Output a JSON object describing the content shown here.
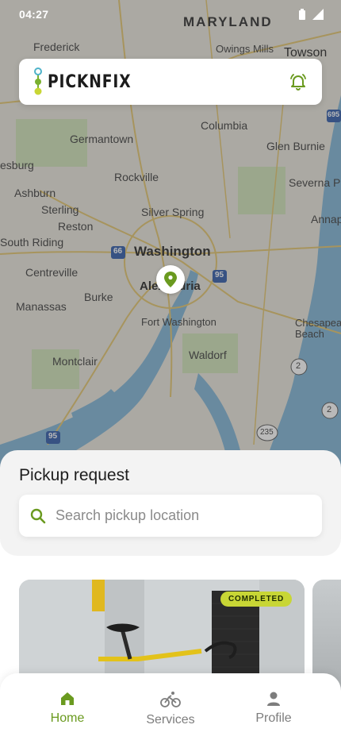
{
  "status_bar": {
    "time": "04:27"
  },
  "header": {
    "logo_text": "PICKNFIX"
  },
  "map": {
    "labels": {
      "maryland": "MARYLAND",
      "frederick": "Frederick",
      "owings_mills": "Owings Mills",
      "towson": "Towson",
      "germantown": "Germantown",
      "columbia": "Columbia",
      "glen_burnie": "Glen Burnie",
      "leesburg": "esburg",
      "rockville": "Rockville",
      "severna_park": "Severna Pa",
      "ashburn": "Ashburn",
      "sterling": "Sterling",
      "silver_spring": "Silver Spring",
      "annapolis": "Annap",
      "reston": "Reston",
      "south_riding": "South Riding",
      "washington": "Washington",
      "centreville": "Centreville",
      "alexandria": "Alexandria",
      "burke": "Burke",
      "manassas": "Manassas",
      "fort_washington": "Fort Washington",
      "chesapeake_beach": "Chesapea Beach",
      "montclair": "Montclair",
      "waldorf": "Waldorf",
      "shield_66": "66",
      "shield_95_a": "95",
      "shield_95_b": "95",
      "shield_2_a": "2",
      "shield_2_b": "2",
      "shield_235": "235",
      "shield_695": "695"
    }
  },
  "pickup": {
    "title": "Pickup request",
    "search_placeholder": "Search pickup location"
  },
  "cards": [
    {
      "status": "COMPLETED"
    }
  ],
  "nav": {
    "items": [
      {
        "label": "Home",
        "active": true
      },
      {
        "label": "Services",
        "active": false
      },
      {
        "label": "Profile",
        "active": false
      }
    ]
  },
  "colors": {
    "accent": "#6a9a1f",
    "badge": "#c8d635",
    "water": "#7fb3d5"
  },
  "icons": {
    "bell": "bell-icon",
    "search": "search-icon",
    "pin": "map-pin-icon",
    "home": "home-icon",
    "services": "bicycle-icon",
    "profile": "person-icon"
  }
}
